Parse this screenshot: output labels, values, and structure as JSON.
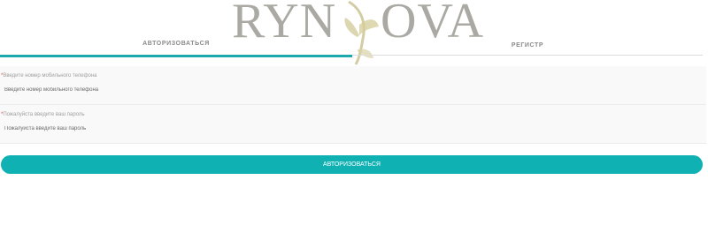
{
  "logo": {
    "left_text": "RYN",
    "right_text": "OVA"
  },
  "tabs": {
    "login": "АВТОРИЗОВАТЬСЯ",
    "register": "РЕГИСТР"
  },
  "form": {
    "phone": {
      "required_mark": "*",
      "label": "Введите номер мобильного телефона",
      "placeholder": "Введите номер мобильного телефона"
    },
    "password": {
      "required_mark": "*",
      "label": "Пожалуйста введите ваш пароль",
      "placeholder": "Пожалуйста введите ваш пароль"
    },
    "submit_label": "АВТОРИЗОВАТЬСЯ"
  },
  "colors": {
    "accent": "#1aa9ad",
    "button": "#0fb1b3",
    "required": "#e05050"
  }
}
